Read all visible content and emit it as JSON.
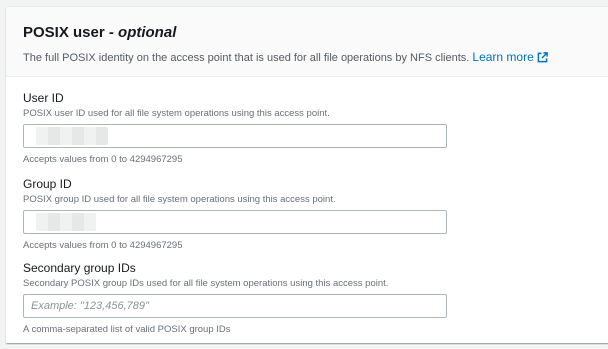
{
  "section": {
    "title": "POSIX user",
    "title_suffix": " - optional",
    "description": "The full POSIX identity on the access point that is used for all file operations by NFS clients.",
    "learn_more": "Learn more"
  },
  "fields": {
    "user_id": {
      "label": "User ID",
      "description": "POSIX user ID used for all file system operations using this access point.",
      "value": "",
      "hint": "Accepts values from 0 to 4294967295"
    },
    "group_id": {
      "label": "Group ID",
      "description": "POSIX group ID used for all file system operations using this access point.",
      "value": "",
      "hint": "Accepts values from 0 to 4294967295"
    },
    "secondary_group_ids": {
      "label": "Secondary group IDs",
      "description": "Secondary POSIX group IDs used for all file system operations using this access point.",
      "placeholder": "Example: \"123,456,789\"",
      "hint": "A comma-separated list of valid POSIX group IDs"
    }
  },
  "colors": {
    "link": "#0073bb",
    "border": "#aab7b8",
    "header_bg": "#fafafa"
  },
  "icons": {
    "learn_more": "external-link-icon"
  }
}
